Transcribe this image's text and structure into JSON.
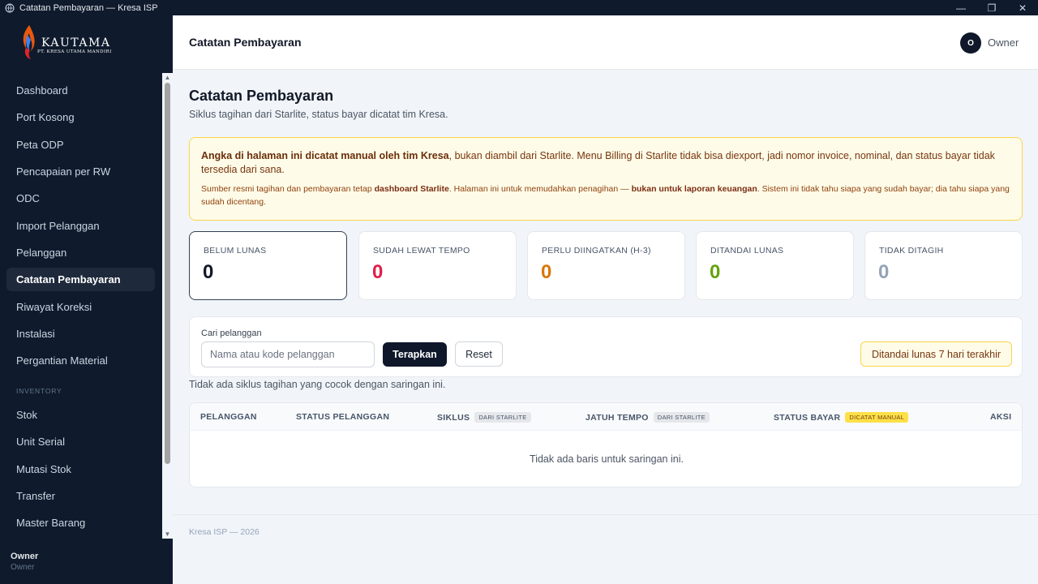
{
  "window": {
    "title": "Catatan Pembayaran — Kresa ISP",
    "controls": [
      "minimize-icon",
      "maximize-icon",
      "close-icon"
    ]
  },
  "brand": {
    "name": "KAUTAMA",
    "subtitle": "PT. KRESA UTAMA MANDIRI"
  },
  "sidebar": {
    "items": [
      {
        "label": "Dashboard"
      },
      {
        "label": "Port Kosong"
      },
      {
        "label": "Peta ODP"
      },
      {
        "label": "Pencapaian per RW"
      },
      {
        "label": "ODC"
      },
      {
        "label": "Import Pelanggan"
      },
      {
        "label": "Pelanggan"
      },
      {
        "label": "Catatan Pembayaran",
        "active": true
      },
      {
        "label": "Riwayat Koreksi"
      },
      {
        "label": "Instalasi"
      },
      {
        "label": "Pergantian Material"
      }
    ],
    "section_inventory": "INVENTORY",
    "inventory_items": [
      {
        "label": "Stok"
      },
      {
        "label": "Unit Serial"
      },
      {
        "label": "Mutasi Stok"
      },
      {
        "label": "Transfer"
      },
      {
        "label": "Master Barang"
      }
    ],
    "user": {
      "name": "Owner",
      "role": "Owner"
    }
  },
  "header": {
    "title": "Catatan Pembayaran",
    "avatar_initial": "O",
    "user_label": "Owner"
  },
  "page": {
    "title": "Catatan Pembayaran",
    "subtitle": "Siklus tagihan dari Starlite, status bayar dicatat tim Kresa."
  },
  "notice": {
    "line1_bold": "Angka di halaman ini dicatat manual oleh tim Kresa",
    "line1_rest": ", bukan diambil dari Starlite. Menu Billing di Starlite tidak bisa diexport, jadi nomor invoice, nominal, dan status bayar tidak tersedia dari sana.",
    "line2_a": "Sumber resmi tagihan dan pembayaran tetap ",
    "line2_b": "dashboard Starlite",
    "line2_c": ". Halaman ini untuk memudahkan penagihan — ",
    "line2_d": "bukan untuk laporan keuangan",
    "line2_e": ". Sistem ini tidak tahu siapa yang sudah bayar; dia tahu siapa yang sudah dicentang."
  },
  "stats": [
    {
      "label": "BELUM LUNAS",
      "value": "0",
      "color": "#111827",
      "selected": true
    },
    {
      "label": "SUDAH LEWAT TEMPO",
      "value": "0",
      "color": "#e11d48"
    },
    {
      "label": "PERLU DIINGATKAN (H-3)",
      "value": "0",
      "color": "#d97706"
    },
    {
      "label": "DITANDAI LUNAS",
      "value": "0",
      "color": "#65a30d"
    },
    {
      "label": "TIDAK DITAGIH",
      "value": "0",
      "color": "#94a3b8"
    }
  ],
  "filter": {
    "label": "Cari pelanggan",
    "placeholder": "Nama atau kode pelanggan",
    "value": "",
    "apply_label": "Terapkan",
    "reset_label": "Reset",
    "badge_label": "Ditandai lunas 7 hari terakhir"
  },
  "empty_cycles": "Tidak ada siklus tagihan yang cocok dengan saringan ini.",
  "table": {
    "columns": [
      {
        "label": "PELANGGAN"
      },
      {
        "label": "STATUS PELANGGAN"
      },
      {
        "label": "SIKLUS",
        "tag": "DARI STARLITE"
      },
      {
        "label": "JATUH TEMPO",
        "tag": "DARI STARLITE"
      },
      {
        "label": "STATUS BAYAR",
        "tag": "DICATAT MANUAL"
      },
      {
        "label": "AKSI"
      }
    ],
    "empty": "Tidak ada baris untuk saringan ini."
  },
  "footer": {
    "text": "Kresa ISP — 2026"
  },
  "colors": {
    "sidebar_bg": "#0f1b2d",
    "accent_dark": "#0f172a",
    "notice_bg": "#fefce8",
    "notice_border": "#fcd34d"
  }
}
